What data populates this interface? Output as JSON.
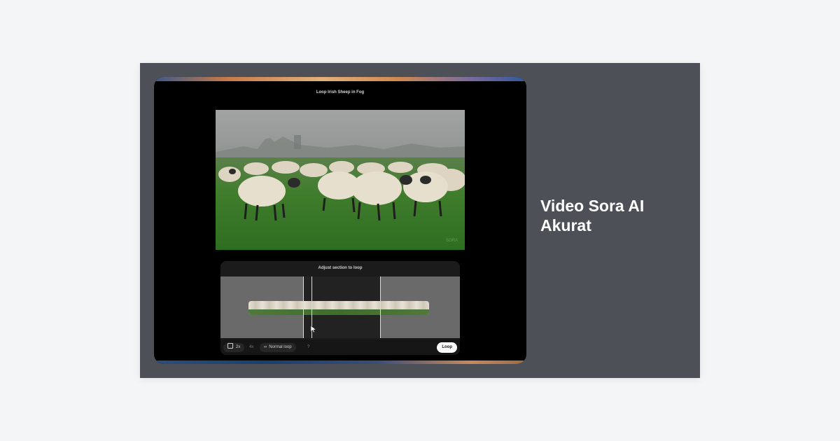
{
  "heading": {
    "line1": "Video Sora AI",
    "line2": "Akurat"
  },
  "player": {
    "title": "Loop Irish Sheep in Fog",
    "watermark": "SORA"
  },
  "loop_panel": {
    "title": "Adjust section to loop",
    "speed_label": "2x",
    "speed_alt_label": "4x",
    "mode_label": "Normal loop",
    "help_label": "?",
    "loop_button_label": "Loop"
  },
  "icons": {
    "speed": "film-icon",
    "mode": "infinity-icon",
    "cursor": "mouse-pointer-icon"
  }
}
